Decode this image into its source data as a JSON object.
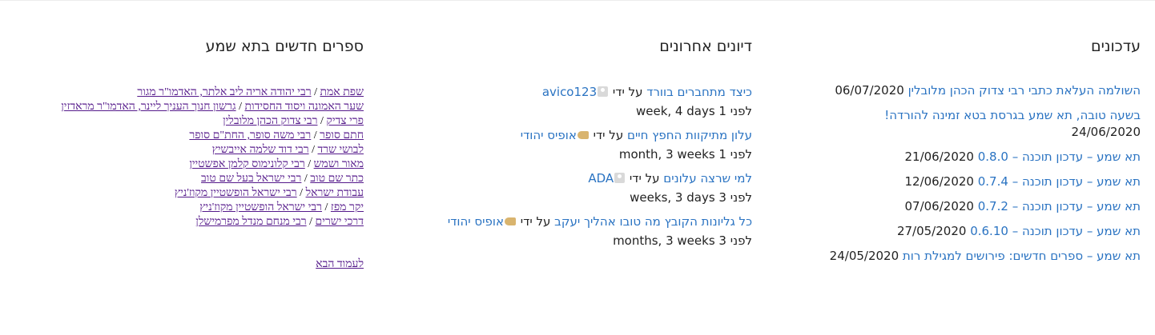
{
  "updates": {
    "heading": "עדכונים",
    "items": [
      {
        "title": "השולמה העלאת כתבי רבי צדוק הכהן מלובלין",
        "date": "06/07/2020"
      },
      {
        "title": "בשעה טובה, תא שמע בגרסת בטא זמינה להורדה!",
        "date": "24/06/2020"
      },
      {
        "title": "תא שמע – עדכון תוכנה – 0.8.0",
        "date": "21/06/2020"
      },
      {
        "title": "תא שמע – עדכון תוכנה – 0.7.4",
        "date": "12/06/2020"
      },
      {
        "title": "תא שמע – עדכון תוכנה – 0.7.2",
        "date": "07/06/2020"
      },
      {
        "title": "תא שמע – עדכון תוכנה – 0.6.10",
        "date": "27/05/2020"
      },
      {
        "title": "תא שמע – ספרים חדשים: פירושים למגילת רות",
        "date": "24/05/2020"
      }
    ]
  },
  "discussions": {
    "heading": "דיונים אחרונים",
    "by_label": "על ידי",
    "items": [
      {
        "title": "כיצד מתחברים בוורד",
        "user": "avico123",
        "icon": "user-icon",
        "time": "לפני 1 week, 4 days"
      },
      {
        "title": "עלון מתיקוות החפץ חיים",
        "user": "אופיס יהודי",
        "icon": "hand-icon",
        "time": "לפני 1 month, 3 weeks"
      },
      {
        "title": "למי שרצה עלונים",
        "user": "ADA",
        "icon": "user-icon",
        "time": "לפני 3 weeks, 3 days"
      },
      {
        "title": "כל גליונות הקובץ מה טובו אהליך יעקב",
        "user": "אופיס יהודי",
        "icon": "hand-icon",
        "time": "לפני 3 months, 3 weeks"
      }
    ]
  },
  "books": {
    "heading": "ספרים חדשים בתא שמע",
    "separator": "/",
    "items": [
      {
        "book": "שפת אמת",
        "author": "רבי יהודה אריה ליב אלתר, האדמו\"ר מגור"
      },
      {
        "book": "שער האמונה ויסוד החסידות",
        "author": "גרשון חנוך העניך ליינר, האדמו\"ר מראדזין"
      },
      {
        "book": "פרי צדיק",
        "author": "רבי צדוק הכהן מלובלין"
      },
      {
        "book": "חתם סופר",
        "author": "רבי משה סופר, החת\"ם סופר"
      },
      {
        "book": "לבושי שרד",
        "author": "רבי דוד שלמה אייבשיץ"
      },
      {
        "book": "מאור ושמש",
        "author": "רבי קלונימוס קלמן אפשטיין"
      },
      {
        "book": "כתר שם טוב",
        "author": "רבי ישראל בעל שם טוב"
      },
      {
        "book": "עבודת ישראל",
        "author": "רבי ישראל הופשטיין מקוז'ניץ"
      },
      {
        "book": "יקר מפז",
        "author": "רבי ישראל הופשטיין מקוז'ניץ"
      },
      {
        "book": "דרכי ישרים",
        "author": "רבי מנחם מנדל מפרמישלן"
      }
    ],
    "next_page": "לעמוד הבא"
  },
  "colors": {
    "link_blue": "#2a73c2",
    "link_visited": "#551a8b"
  }
}
